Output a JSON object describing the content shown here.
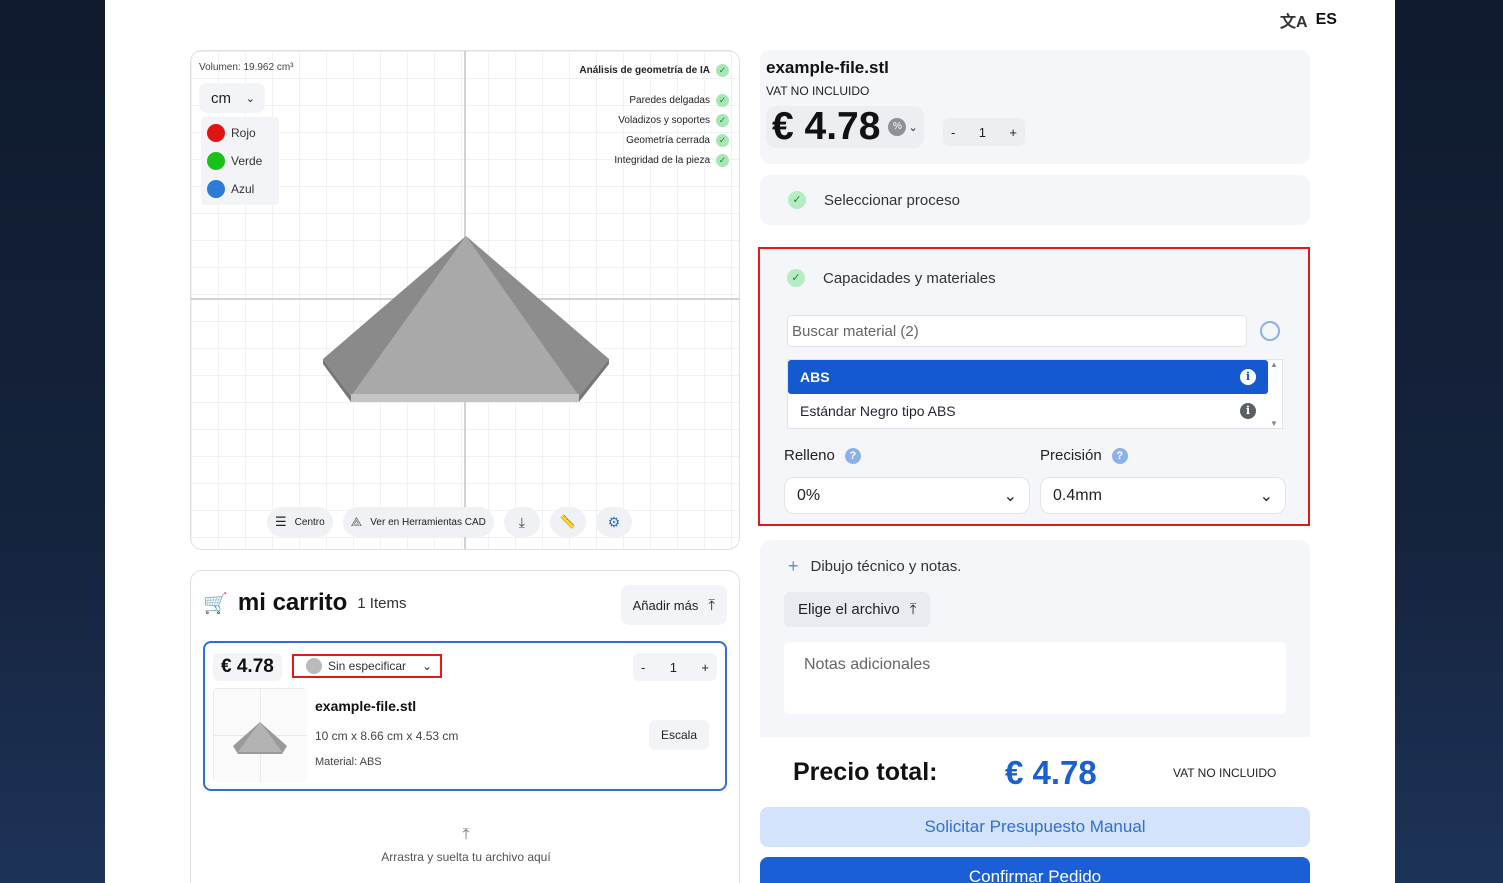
{
  "header": {
    "language": "ES"
  },
  "viewer": {
    "volume": "Volumen: 19.962 cm³",
    "unit": "cm",
    "colors": [
      {
        "label": "Rojo",
        "color": "#e01414"
      },
      {
        "label": "Verde",
        "color": "#19c219"
      },
      {
        "label": "Azul",
        "color": "#2e7ad9"
      }
    ],
    "analysis_title": "Análisis de geometría de IA",
    "checks": [
      "Paredes delgadas",
      "Voladizos y soportes",
      "Geometría cerrada",
      "Integridad de la pieza"
    ],
    "toolbar": {
      "center": "Centro",
      "cad": "Ver en Herramientas CAD"
    }
  },
  "cart": {
    "title": "mi carrito",
    "count": "1 Items",
    "add_more": "Añadir más",
    "item": {
      "price": "€ 4.78",
      "material_select": "Sin especificar",
      "qty": "1",
      "name": "example-file.stl",
      "dims": "10 cm x 8.66 cm x 4.53 cm",
      "material": "Material: ABS",
      "scale": "Escala"
    },
    "dropzone": "Arrastra y suelta tu archivo aquí"
  },
  "file_card": {
    "name": "example-file.stl",
    "vat": "VAT NO INCLUIDO",
    "price": "€ 4.78",
    "qty": "1"
  },
  "process": {
    "label": "Seleccionar proceso"
  },
  "materials": {
    "title": "Capacidades y materiales",
    "search_placeholder": "Buscar material (2)",
    "options": [
      "ABS",
      "Estándar Negro tipo ABS"
    ],
    "infill_label": "Relleno",
    "infill_value": "0%",
    "precision_label": "Precisión",
    "precision_value": "0.4mm"
  },
  "notes": {
    "title": "Dibujo técnico y notas.",
    "file_button": "Elige el archivo",
    "placeholder": "Notas adicionales"
  },
  "total": {
    "label": "Precio total:",
    "amount": "€ 4.78",
    "vat": "VAT NO INCLUIDO"
  },
  "actions": {
    "quote": "Solicitar Presupuesto Manual",
    "confirm": "Confirmar Pedido"
  }
}
